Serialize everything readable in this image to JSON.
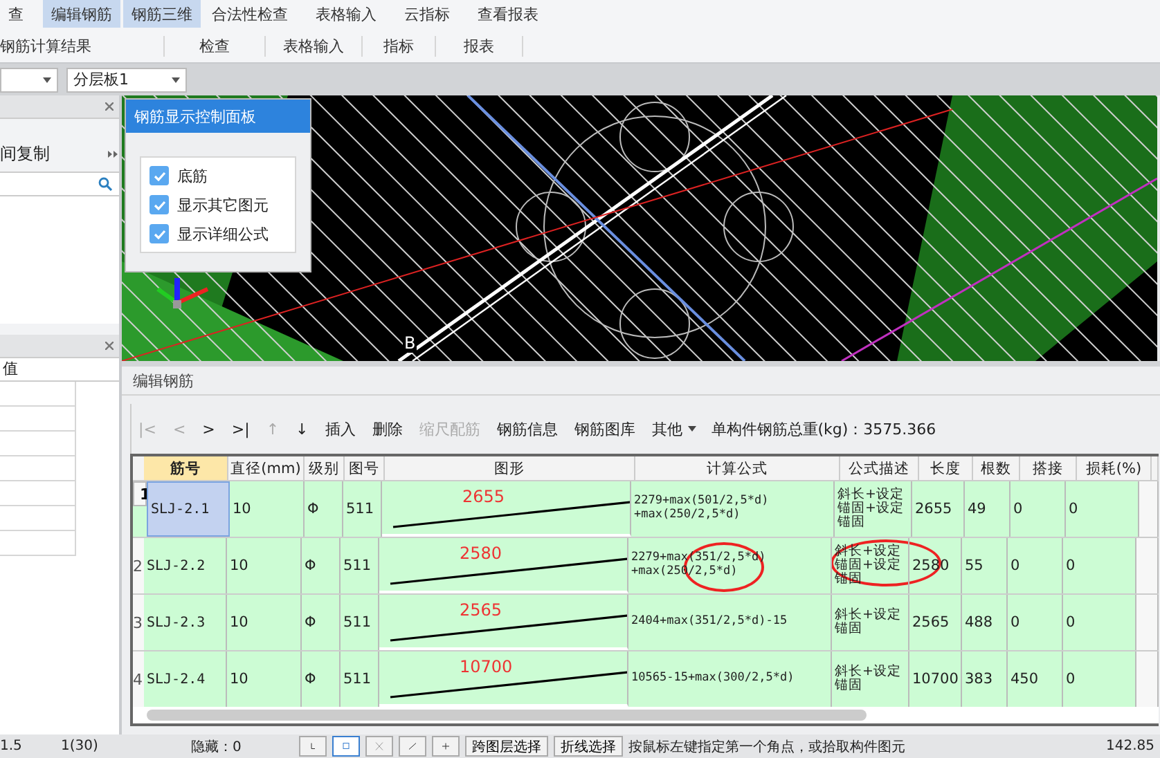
{
  "ribbon": {
    "buttons": [
      {
        "label": "查",
        "selected": false
      },
      {
        "label": "编辑钢筋",
        "selected": true
      },
      {
        "label": "钢筋三维",
        "selected": true
      },
      {
        "label": "合法性检查",
        "selected": false
      },
      {
        "label": "表格输入",
        "selected": false
      },
      {
        "label": "云指标",
        "selected": false
      },
      {
        "label": "查看报表",
        "selected": false
      }
    ],
    "groups": [
      "钢筋计算结果",
      "检查",
      "表格输入",
      "指标",
      "报表"
    ]
  },
  "selector": {
    "value": "分层板1"
  },
  "left_panel": {
    "action": "间复制",
    "column_header": "值"
  },
  "viewport": {
    "axis_label": "B"
  },
  "control_panel": {
    "title": "钢筋显示控制面板",
    "options": [
      {
        "label": "底筋",
        "checked": true
      },
      {
        "label": "显示其它图元",
        "checked": true
      },
      {
        "label": "显示详细公式",
        "checked": true
      }
    ]
  },
  "editor": {
    "title": "编辑钢筋",
    "toolbar": [
      {
        "label": "|<",
        "disabled": true
      },
      {
        "label": "<",
        "disabled": true
      },
      {
        "label": ">",
        "disabled": false
      },
      {
        "label": ">|",
        "disabled": false
      },
      {
        "label": "↑",
        "disabled": true
      },
      {
        "label": "↓",
        "disabled": false
      },
      {
        "label": "插入",
        "disabled": false
      },
      {
        "label": "删除",
        "disabled": false
      },
      {
        "label": "缩尺配筋",
        "disabled": true
      },
      {
        "label": "钢筋信息",
        "disabled": false
      },
      {
        "label": "钢筋图库",
        "disabled": false
      },
      {
        "label": "其他",
        "disabled": false
      }
    ],
    "total": "单构件钢筋总重(kg)：3575.366",
    "columns": [
      "筋号",
      "直径(mm)",
      "级别",
      "图号",
      "图形",
      "计算公式",
      "公式描述",
      "长度",
      "根数",
      "搭接",
      "损耗(%)"
    ],
    "rows": [
      {
        "index": "1",
        "selected": true,
        "cells": [
          "SLJ-2.1",
          "10",
          "Φ",
          "511",
          "2655",
          "2279+max(501/2,5*d)\n+max(250/2,5*d)",
          "斜长+设定锚固+设定锚固",
          "2655",
          "49",
          "0",
          "0"
        ]
      },
      {
        "index": "2",
        "selected": false,
        "cells": [
          "SLJ-2.2",
          "10",
          "Φ",
          "511",
          "2580",
          "2279+max(351/2,5*d)\n+max(250/2,5*d)",
          "斜长+设定锚固+设定锚固",
          "2580",
          "55",
          "0",
          "0"
        ]
      },
      {
        "index": "3",
        "selected": false,
        "cells": [
          "SLJ-2.3",
          "10",
          "Φ",
          "511",
          "2565",
          "2404+max(351/2,5*d)-15",
          "斜长+设定锚固",
          "2565",
          "488",
          "0",
          "0"
        ]
      },
      {
        "index": "4",
        "selected": false,
        "cells": [
          "SLJ-2.4",
          "10",
          "Φ",
          "511",
          "10700",
          "10565-15+max(300/2,5*d)",
          "斜长+设定锚固",
          "10700",
          "383",
          "450",
          "0"
        ]
      }
    ]
  },
  "status_bar": {
    "items": [
      "1.5",
      "1(30)",
      "隐藏：0"
    ],
    "buttons": [
      "跨图层选择",
      "折线选择"
    ],
    "hint": "按鼠标左键指定第一个角点，或拾取构件图元",
    "coordinate": "142.85"
  }
}
